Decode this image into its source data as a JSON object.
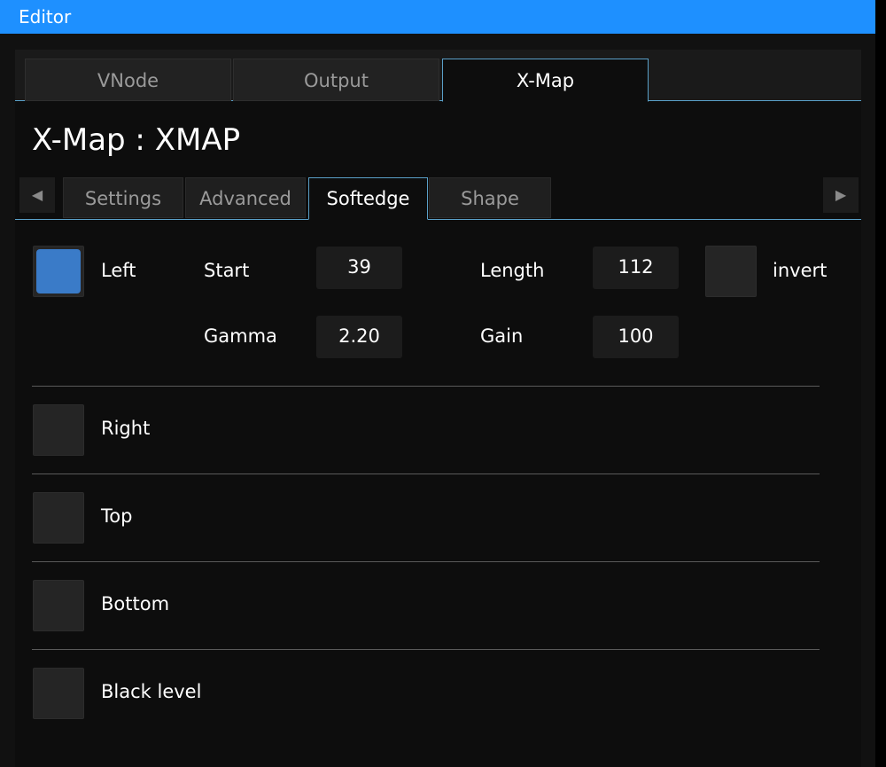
{
  "window": {
    "title": "Editor"
  },
  "primary_tabs": [
    {
      "label": "VNode",
      "active": false
    },
    {
      "label": "Output",
      "active": false
    },
    {
      "label": "X-Map",
      "active": true
    }
  ],
  "page_title": "X-Map : XMAP",
  "sub_tabs": [
    {
      "label": "Settings",
      "active": false
    },
    {
      "label": "Advanced",
      "active": false
    },
    {
      "label": "Softedge",
      "active": true
    },
    {
      "label": "Shape",
      "active": false
    }
  ],
  "nav": {
    "prev_icon": "caret-left-icon",
    "next_icon": "caret-right-icon"
  },
  "left_section": {
    "label": "Left",
    "checked": true,
    "start_label": "Start",
    "start_value": "39",
    "length_label": "Length",
    "length_value": "112",
    "invert_label": "invert",
    "invert_checked": false,
    "gamma_label": "Gamma",
    "gamma_value": "2.20",
    "gain_label": "Gain",
    "gain_value": "100"
  },
  "sections": [
    {
      "label": "Right",
      "checked": false
    },
    {
      "label": "Top",
      "checked": false
    },
    {
      "label": "Bottom",
      "checked": false
    },
    {
      "label": "Black level",
      "checked": false
    }
  ],
  "colors": {
    "titlebar": "#1e90ff",
    "accent": "#5aa0c8",
    "checkbox_on": "#3a7bc8"
  }
}
